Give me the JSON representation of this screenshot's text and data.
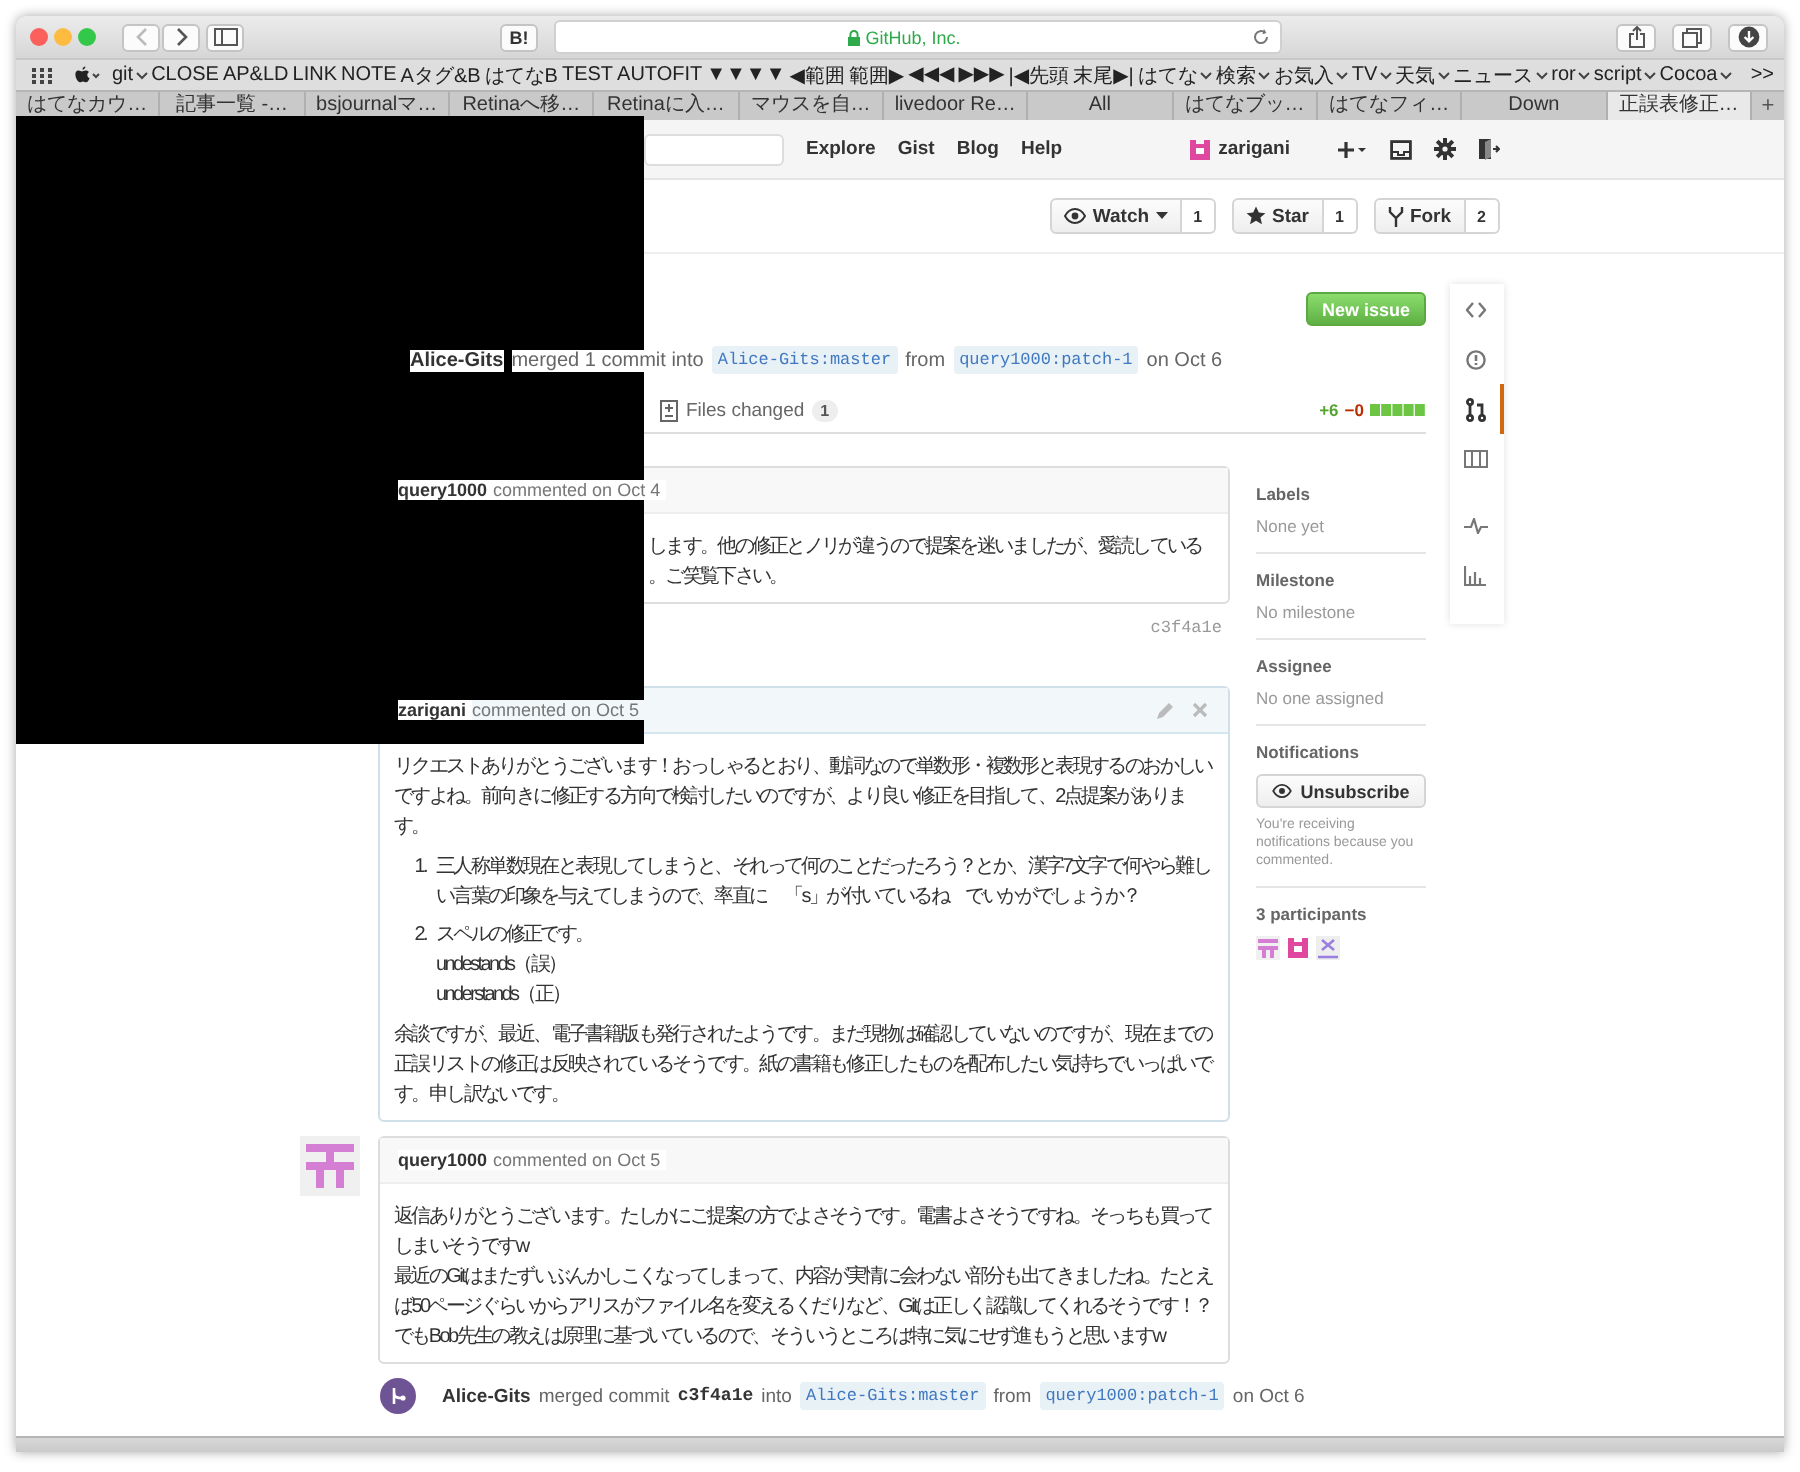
{
  "browser": {
    "bookmarklet": "B!",
    "address": "GitHub, Inc.",
    "bookmarks": [
      {
        "label": "git",
        "dropdown": true
      },
      {
        "label": "CLOSE",
        "dropdown": false
      },
      {
        "label": "AP&LD",
        "dropdown": false
      },
      {
        "label": "LINK",
        "dropdown": false
      },
      {
        "label": "NOTE",
        "dropdown": false
      },
      {
        "label": "Aタグ&B",
        "dropdown": false
      },
      {
        "label": "はてなB",
        "dropdown": false
      },
      {
        "label": "TEST",
        "dropdown": false
      },
      {
        "label": "AUTOFIT",
        "dropdown": false
      },
      {
        "label": "▼▼▼▼",
        "dropdown": false
      },
      {
        "label": "◀範囲",
        "dropdown": false
      },
      {
        "label": "範囲▶",
        "dropdown": false
      },
      {
        "label": "◀◀◀",
        "dropdown": false
      },
      {
        "label": "▶▶▶",
        "dropdown": false
      },
      {
        "label": "|◀先頭",
        "dropdown": false
      },
      {
        "label": "末尾▶|",
        "dropdown": false
      },
      {
        "label": "はてな",
        "dropdown": true
      },
      {
        "label": "検索",
        "dropdown": true
      },
      {
        "label": "お気入",
        "dropdown": true
      },
      {
        "label": "TV",
        "dropdown": true
      },
      {
        "label": "天気",
        "dropdown": true
      },
      {
        "label": "ニュース",
        "dropdown": true
      },
      {
        "label": "ror",
        "dropdown": true
      },
      {
        "label": "script",
        "dropdown": true
      },
      {
        "label": "Cocoa",
        "dropdown": true
      }
    ],
    "overflow": ">>",
    "tabs": [
      {
        "label": "はてなカウ…",
        "selected": false
      },
      {
        "label": "記事一覧 -…",
        "selected": false
      },
      {
        "label": "bsjournalマ…",
        "selected": false
      },
      {
        "label": "Retinaへ移…",
        "selected": false
      },
      {
        "label": "Retinaに入…",
        "selected": false
      },
      {
        "label": "マウスを自…",
        "selected": false
      },
      {
        "label": "livedoor Re…",
        "selected": false
      },
      {
        "label": "All",
        "selected": false
      },
      {
        "label": "はてなブッ…",
        "selected": false
      },
      {
        "label": "はてなフィ…",
        "selected": false
      },
      {
        "label": "Down",
        "selected": false
      },
      {
        "label": "正誤表修正…",
        "selected": true
      }
    ],
    "new_tab": "+"
  },
  "github": {
    "nav": [
      "Explore",
      "Gist",
      "Blog",
      "Help"
    ],
    "user": "zarigani"
  },
  "repo_actions": [
    {
      "kind": "watch",
      "label": "Watch",
      "dropdown": true,
      "count": "1"
    },
    {
      "kind": "star",
      "label": "Star",
      "dropdown": false,
      "count": "1"
    },
    {
      "kind": "fork",
      "label": "Fork",
      "dropdown": false,
      "count": "2"
    }
  ],
  "new_issue": "New issue",
  "merge_summary": {
    "author": "Alice-Gits",
    "text": "merged 1 commit into",
    "base": "Alice-Gits:master",
    "from": "from",
    "head": "query1000:patch-1",
    "date": "on Oct 6"
  },
  "pr_tabs": [
    {
      "label": "Files changed",
      "count": "1"
    }
  ],
  "diffstat": {
    "added": "+6",
    "removed": "−0"
  },
  "timeline": [
    {
      "kind": "comment",
      "author": "query1000",
      "action": "commented on Oct 4",
      "owner": false,
      "editable": false,
      "blocks": [
        {
          "lines": [
            "します。他の修正とノリが違うので提案を迷いましたが、愛読している",
            "。ご笑覧下さい。"
          ]
        }
      ]
    },
    {
      "kind": "commit_ref",
      "sha": "c3f4a1e"
    },
    {
      "kind": "comment",
      "author": "zarigani",
      "action": "commented on Oct 5",
      "owner": true,
      "editable": true,
      "blocks": [
        {
          "lines": [
            "リクエストありがとうございます！おっしゃるとおり、動詞なので単数形・複数形と表現するのおかしいですよね。前向きに修正する方向で検討したいのですが、より良い修正を目指して、2点提案があります。"
          ]
        },
        {
          "items": [
            {
              "number": "1.",
              "lines": [
                "三人称単数現在と表現してしまうと、それって何のことだったろう？とか、漢字7文字で何やら難しい言葉の印象を与えてしまうので、率直に　「s」が付いているね　でいかがでしょうか？"
              ]
            },
            {
              "number": "2.",
              "lines": [
                "スペルの修正です。",
                "undestands（誤）",
                "understands（正）"
              ]
            }
          ]
        },
        {
          "lines": [
            "余談ですが、最近、電子書籍版も発行されたようです。まだ現物は確認していないのですが、現在までの正誤リストの修正は反映されているそうです。紙の書籍も修正したものを配布したい気持ちでいっぱいです。申し訳ないです。"
          ]
        }
      ]
    },
    {
      "kind": "comment",
      "author": "query1000",
      "action": "commented on Oct 5",
      "owner": false,
      "editable": false,
      "blocks": [
        {
          "lines": [
            "返信ありがとうございます。たしかにご提案の方でよさそうです。電書よさそうですね。そっちも買ってしまいそうですw",
            "最近のGitはまたずいぶんかしこくなってしまって、内容が実情に会わない部分も出てきましたね。たとえば50ページぐらいからアリスがファイル名を変えるくだりなど、Gitは正しく認識してくれるそうです！？でもBob先生の教えは原理に基づいているので、そういうところは特に気にせず進もうと思いますw"
          ]
        }
      ]
    },
    {
      "kind": "merge_event",
      "author": "Alice-Gits",
      "action": "merged commit",
      "sha": "c3f4a1e",
      "into": "into",
      "base": "Alice-Gits:master",
      "from": "from",
      "head": "query1000:patch-1",
      "date": "on Oct 6"
    }
  ],
  "sidebar": {
    "sections": [
      {
        "title": "Labels",
        "value": "None yet"
      },
      {
        "title": "Milestone",
        "value": "No milestone"
      },
      {
        "title": "Assignee",
        "value": "No one assigned"
      }
    ],
    "notifications": {
      "title": "Notifications",
      "button": "Unsubscribe",
      "note": "You're receiving notifications because you commented."
    },
    "participants": "3 participants"
  },
  "repo_nav": [
    {
      "kind": "code",
      "selected": false
    },
    {
      "kind": "issues",
      "selected": false
    },
    {
      "kind": "pulls",
      "selected": true
    },
    {
      "kind": "wiki",
      "selected": false
    },
    {
      "kind": "pulse",
      "selected": false
    },
    {
      "kind": "graphs",
      "selected": false
    }
  ]
}
